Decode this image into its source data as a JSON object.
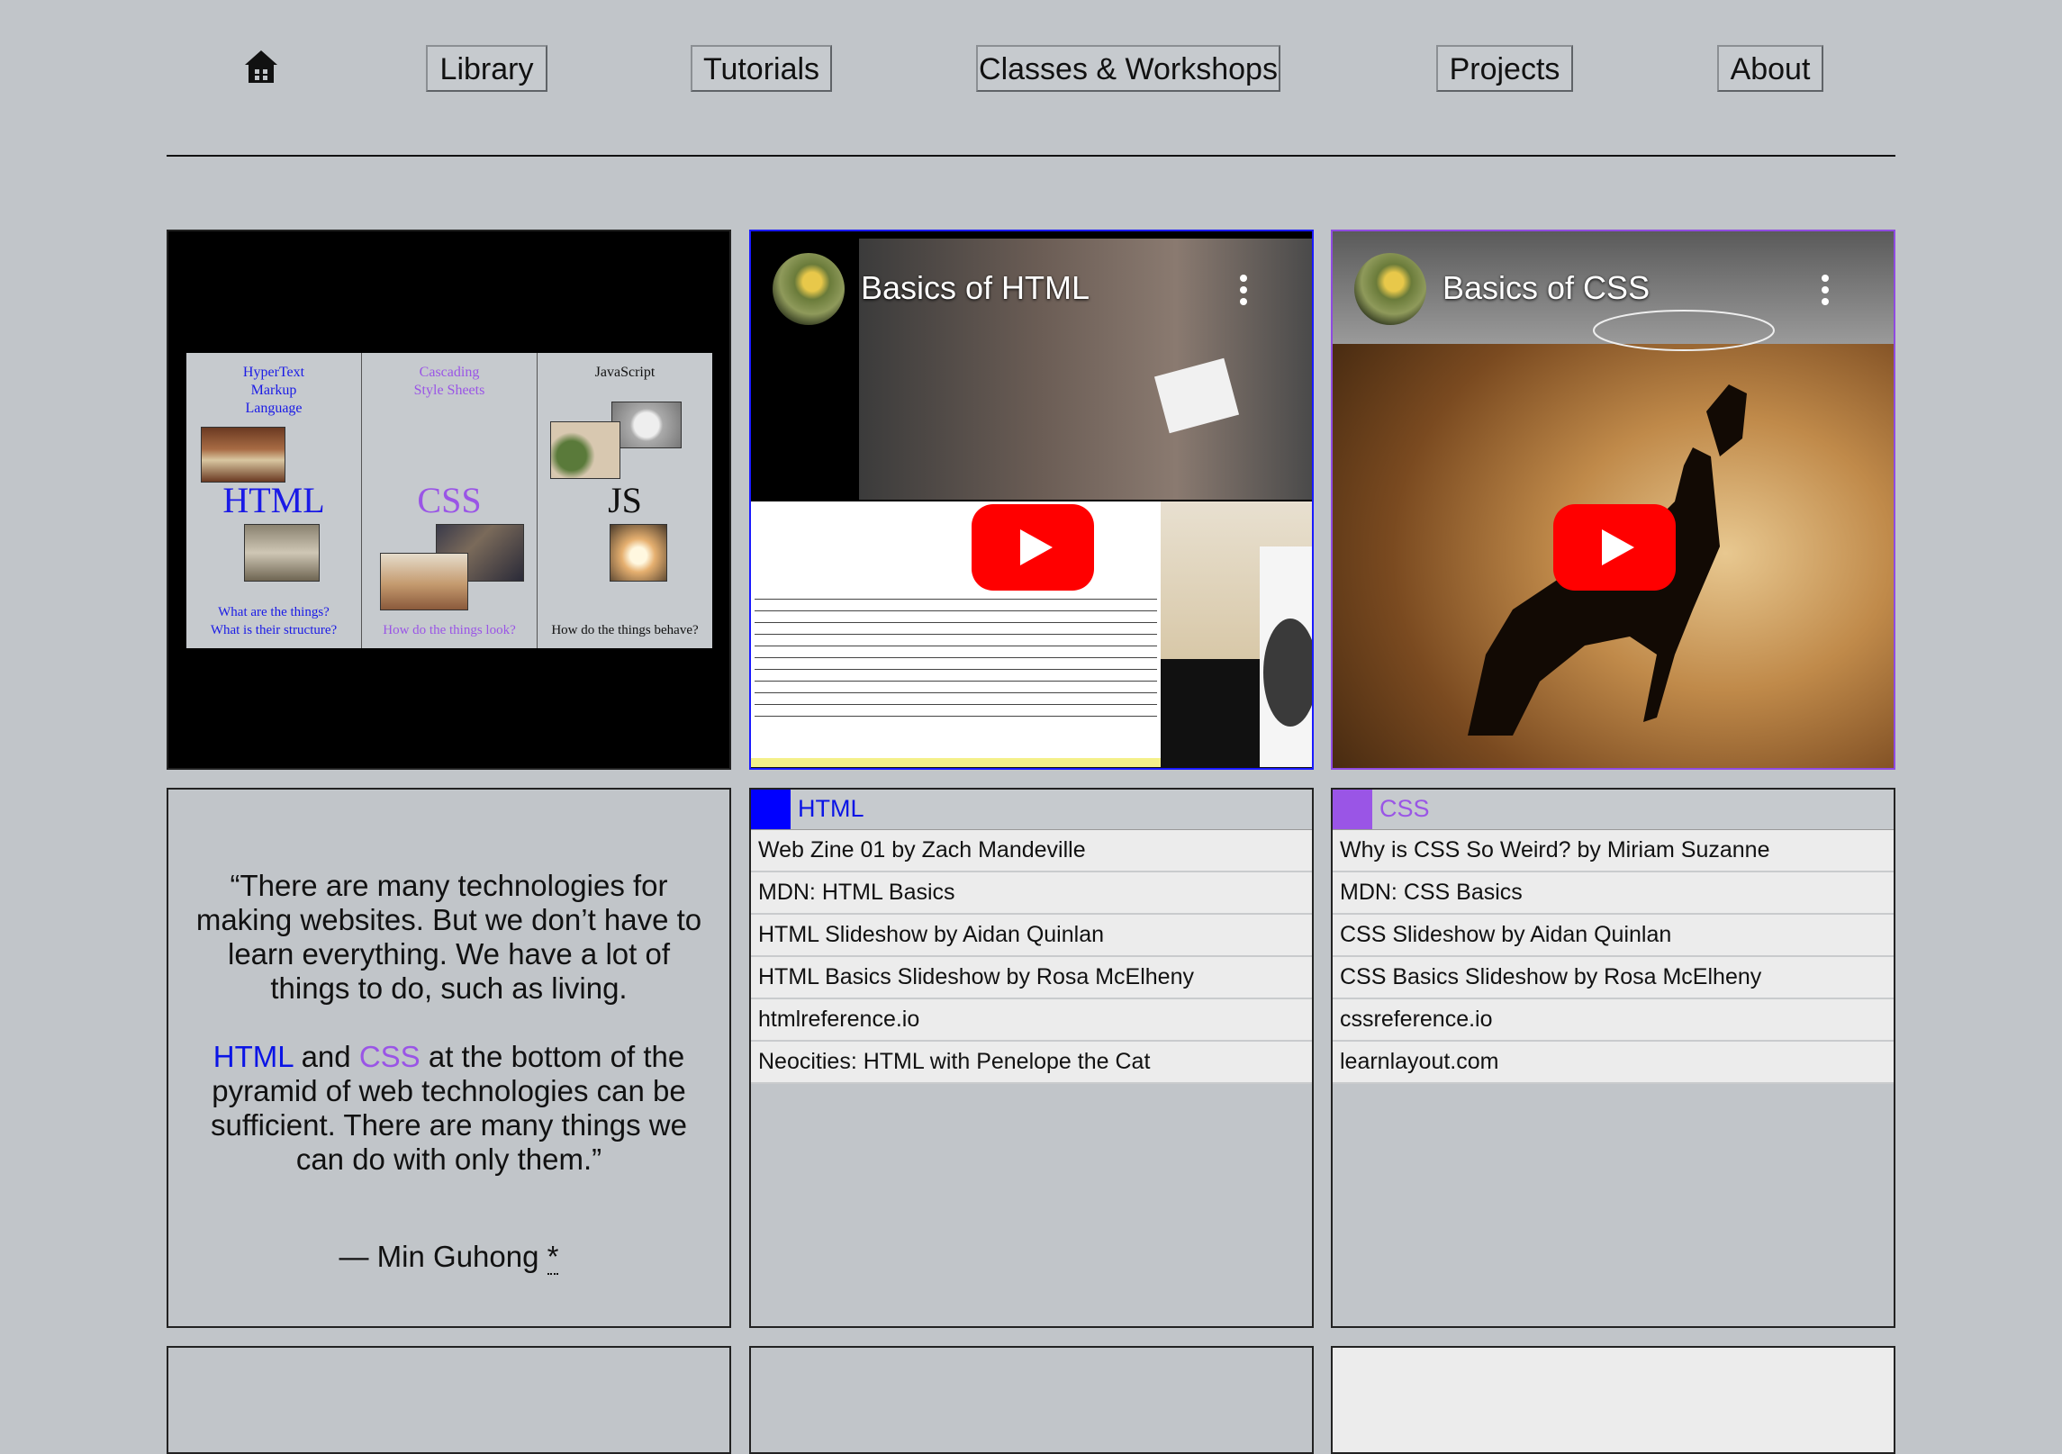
{
  "nav": {
    "home_icon": "house-icon",
    "items": [
      {
        "label": "Library"
      },
      {
        "label": "Tutorials"
      },
      {
        "label": "Classes & Workshops"
      },
      {
        "label": "Projects"
      },
      {
        "label": "About"
      }
    ]
  },
  "diagram": {
    "columns": [
      {
        "top_lines": [
          "HyperText",
          "Markup",
          "Language"
        ],
        "big": "HTML",
        "bottom_lines": [
          "What are the things?",
          "What is their structure?"
        ],
        "color": "#1a1ae6"
      },
      {
        "top_lines": [
          "Cascading",
          "Style Sheets"
        ],
        "big": "CSS",
        "bottom_lines": [
          "How do the things look?"
        ],
        "color": "#9a55e6"
      },
      {
        "top_lines": [
          "JavaScript"
        ],
        "big": "JS",
        "bottom_lines": [
          "How do the things behave?"
        ],
        "color": "#111111"
      }
    ]
  },
  "videos": {
    "html": {
      "title": "Basics of HTML"
    },
    "css": {
      "title": "Basics of CSS"
    }
  },
  "quote": {
    "p1": "“There are many technologies for making websites. But we don’t have to learn everything. We have a lot of things to do, such as living.",
    "p2_html": "HTML",
    "p2_and": " and ",
    "p2_css": "CSS",
    "p2_rest": " at the bottom of the pyramid of web technologies can be sufficient. There are many things we can do with only them.”",
    "author": "— Min Guhong ",
    "author_mark": "*"
  },
  "html_links": {
    "heading": "HTML",
    "color": "#0000ff",
    "items": [
      "Web Zine 01 by Zach Mandeville",
      "MDN: HTML Basics",
      "HTML Slideshow by Aidan Quinlan",
      "HTML Basics Slideshow by Rosa McElheny",
      "htmlreference.io",
      "Neocities: HTML with Penelope the Cat"
    ]
  },
  "css_links": {
    "heading": "CSS",
    "color": "#9a55e6",
    "items": [
      "Why is CSS So Weird? by Miriam Suzanne",
      "MDN: CSS Basics",
      "CSS Slideshow by Aidan Quinlan",
      "CSS Basics Slideshow by Rosa McElheny",
      "cssreference.io",
      "learnlayout.com"
    ]
  }
}
